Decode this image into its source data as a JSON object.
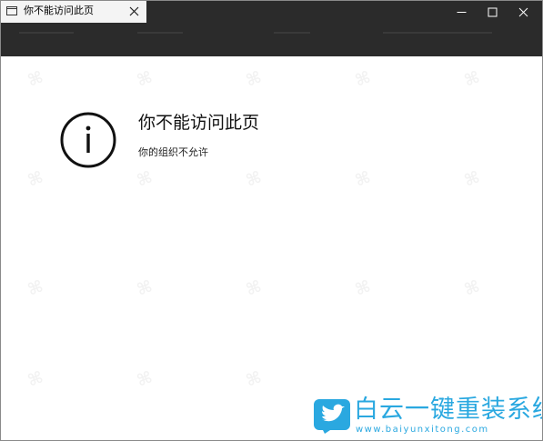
{
  "tab": {
    "title": "你不能访问此页"
  },
  "window_controls": {
    "minimize": "minimize",
    "maximize": "maximize",
    "close": "close"
  },
  "page": {
    "heading": "你不能访问此页",
    "subtext": "你的组织不允许"
  },
  "icons": {
    "tab": "window-icon",
    "tab_close": "close-icon",
    "info": "info-icon",
    "brand": "bird-logo-icon"
  },
  "brand": {
    "name": "白云一键重装系统",
    "url": "www.baiyunxitong.com",
    "color": "#2aa8e0"
  },
  "colors": {
    "titlebar": "#2b2b2b",
    "tab_bg": "#f4f4f4",
    "content_bg": "#ffffff"
  }
}
